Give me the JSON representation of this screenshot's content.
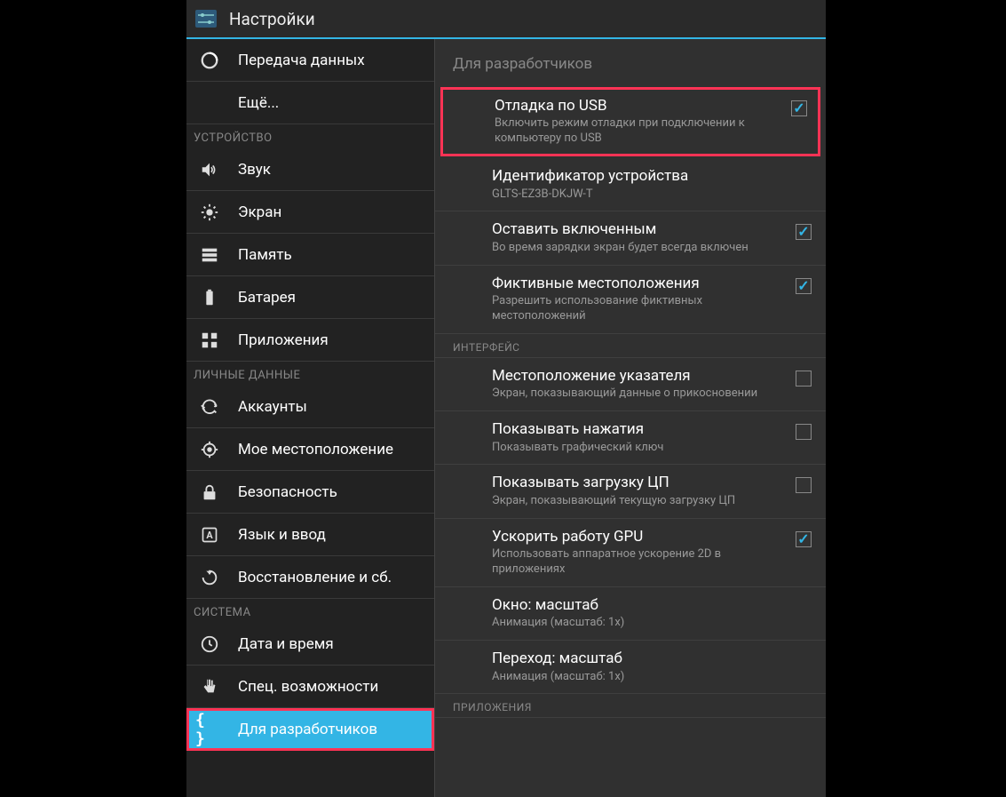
{
  "header": {
    "title": "Настройки"
  },
  "sidebar": {
    "items": [
      {
        "label": "Передача данных",
        "icon": "data-usage"
      },
      {
        "label": "Ещё...",
        "icon": ""
      }
    ],
    "sections": [
      {
        "header": "УСТРОЙСТВО",
        "items": [
          {
            "label": "Звук",
            "icon": "volume"
          },
          {
            "label": "Экран",
            "icon": "brightness"
          },
          {
            "label": "Память",
            "icon": "storage"
          },
          {
            "label": "Батарея",
            "icon": "battery"
          },
          {
            "label": "Приложения",
            "icon": "apps"
          }
        ]
      },
      {
        "header": "ЛИЧНЫЕ ДАННЫЕ",
        "items": [
          {
            "label": "Аккаунты",
            "icon": "sync"
          },
          {
            "label": "Мое местоположение",
            "icon": "location"
          },
          {
            "label": "Безопасность",
            "icon": "lock"
          },
          {
            "label": "Язык и ввод",
            "icon": "language"
          },
          {
            "label": "Восстановление и сб.",
            "icon": "backup"
          }
        ]
      },
      {
        "header": "СИСТЕМА",
        "items": [
          {
            "label": "Дата и время",
            "icon": "clock"
          },
          {
            "label": "Спец. возможности",
            "icon": "hand"
          },
          {
            "label": "Для разработчиков",
            "icon": "braces",
            "selected": true,
            "highlighted": true
          }
        ]
      }
    ]
  },
  "content": {
    "title": "Для разработчиков",
    "prefs": [
      {
        "title": "Отладка по USB",
        "summary": "Включить режим отладки при подключении к компьютеру по USB",
        "checked": true,
        "highlighted": true
      },
      {
        "title": "Идентификатор устройства",
        "summary": "GLTS-EZ3B-DKJW-T",
        "checkbox": false
      },
      {
        "title": "Оставить включенным",
        "summary": "Во время зарядки экран будет всегда включен",
        "checked": true
      },
      {
        "title": "Фиктивные местоположения",
        "summary": "Разрешить использование фиктивных местоположений",
        "checked": true
      }
    ],
    "cat1": "ИНТЕРФЕЙС",
    "prefs2": [
      {
        "title": "Местоположение указателя",
        "summary": "Экран, показывающий данные о прикосновении",
        "checked": false
      },
      {
        "title": "Показывать нажатия",
        "summary": "Показывать графический ключ",
        "checked": false
      },
      {
        "title": "Показывать загрузку ЦП",
        "summary": "Экран, показывающий текущую загрузку ЦП",
        "checked": false
      },
      {
        "title": "Ускорить работу GPU",
        "summary": "Использовать аппаратное ускорение 2D в приложениях",
        "checked": true
      },
      {
        "title": "Окно: масштаб",
        "summary": "Анимация (масштаб: 1x)",
        "checkbox": false
      },
      {
        "title": "Переход: масштаб",
        "summary": "Анимация (масштаб: 1x)",
        "checkbox": false
      }
    ],
    "cat2": "ПРИЛОЖЕНИЯ"
  }
}
